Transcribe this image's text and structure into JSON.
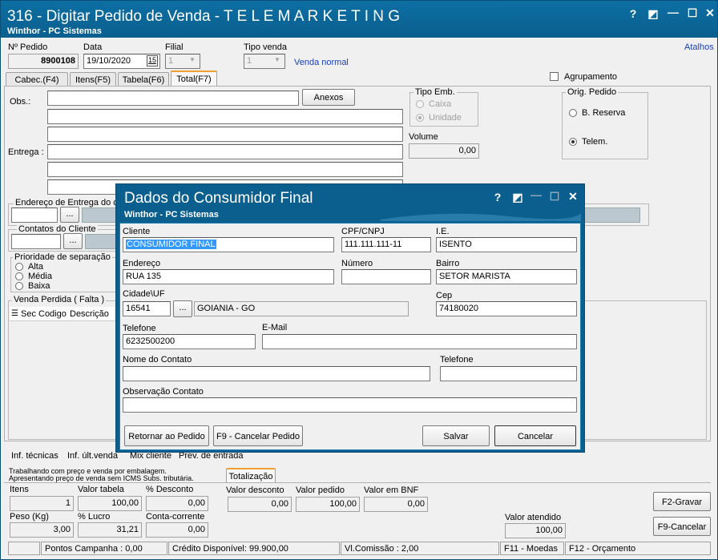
{
  "window": {
    "title": "316 - Digitar Pedido de Venda - T E L E M A R K E T I N G",
    "subtitle": "Winthor - PC Sistemas",
    "atalhos": "Atalhos",
    "buttons": {
      "help": "?",
      "restore": "◩",
      "minimize": "—",
      "maximize": "☐",
      "close": "✕"
    }
  },
  "header": {
    "pedido_label": "Nº Pedido",
    "pedido_value": "8900108",
    "data_label": "Data",
    "data_value": "19/10/2020",
    "calendar": "15",
    "filial_label": "Filial",
    "filial_value": "1",
    "tipo_venda_label": "Tipo venda",
    "tipo_venda_value": "1",
    "tipo_venda_desc": "Venda normal",
    "agrupamento": "Agrupamento"
  },
  "tabs": [
    {
      "label": "Cabec.(F4)"
    },
    {
      "label": "Itens(F5)"
    },
    {
      "label": "Tabela(F6)"
    },
    {
      "label": "Total(F7)"
    }
  ],
  "main": {
    "obs_label": "Obs.:",
    "anexos": "Anexos",
    "entrega_label": "Entrega :",
    "tipo_emb_label": "Tipo Emb.",
    "caixa": "Caixa",
    "unidade": "Unidade",
    "volume_label": "Volume",
    "volume_value": "0,00",
    "orig_pedido_label": "Orig. Pedido",
    "b_reserva": "B. Reserva",
    "telem": "Telem.",
    "endereco_entrega": "Endereço de Entrega do cl",
    "contatos": "Contatos do Cliente",
    "ellipsis": "...",
    "prioridade_label": "Prioridade de separação",
    "alta": "Alta",
    "media": "Média",
    "baixa": "Baixa",
    "venda_perdida": "Venda Perdida ( Falta )",
    "grid_cols": [
      "Sec",
      "Codigo",
      "Descrição"
    ]
  },
  "bottom_links": [
    "Inf. técnicas",
    "Inf. últ.venda",
    "Mix cliente",
    "Prev. de entrada"
  ],
  "info_text": [
    "Trabalhando com preço e venda por embalagem.",
    "Apresentando preço de venda sem ICMS Subs. tributária."
  ],
  "totalizacao_tab": "Totalização",
  "totals": {
    "itens_label": "Itens",
    "itens_value": "1",
    "valor_tabela_label": "Valor tabela",
    "valor_tabela_value": "100,00",
    "pct_desconto_label": "% Desconto",
    "pct_desconto_value": "0,00",
    "peso_label": "Peso (Kg)",
    "peso_value": "3,00",
    "pct_lucro_label": "% Lucro",
    "pct_lucro_value": "31,21",
    "conta_corrente_label": "Conta-corrente",
    "conta_corrente_value": "0,00",
    "valor_desconto_label": "Valor desconto",
    "valor_desconto_value": "0,00",
    "valor_pedido_label": "Valor pedido",
    "valor_pedido_value": "100,00",
    "valor_bnf_label": "Valor em BNF",
    "valor_bnf_value": "0,00",
    "valor_atendido_label": "Valor atendido",
    "valor_atendido_value": "100,00"
  },
  "actions": {
    "gravar": "F2-Gravar",
    "cancelar": "F9-Cancelar"
  },
  "status": {
    "pontos": "Pontos Campanha : 0,00",
    "credito": "Crédito Disponível: 99.900,00",
    "comissao": "Vl.Comissão : 2,00",
    "moedas": "F11 - Moedas",
    "orcamento": "F12 - Orçamento"
  },
  "dialog": {
    "title": "Dados do Consumidor Final",
    "subtitle": "Winthor - PC Sistemas",
    "cliente_label": "Cliente",
    "cliente_value": "CONSUMIDOR FINAL",
    "cpf_label": "CPF/CNPJ",
    "cpf_value": "111.111.111-11",
    "ie_label": "I.E.",
    "ie_value": "ISENTO",
    "endereco_label": "Endereço",
    "endereco_value": "RUA 135",
    "numero_label": "Número",
    "numero_value": "",
    "bairro_label": "Bairro",
    "bairro_value": "SETOR MARISTA",
    "cidade_label": "Cidade\\UF",
    "cidade_code": "16541",
    "cidade_name": "GOIANIA - GO",
    "cep_label": "Cep",
    "cep_value": "74180020",
    "telefone_label": "Telefone",
    "telefone_value": "6232500200",
    "email_label": "E-Mail",
    "email_value": "",
    "nome_contato_label": "Nome do Contato",
    "telefone2_label": "Telefone",
    "obs_contato_label": "Observação Contato",
    "btn_retornar": "Retornar ao Pedido",
    "btn_cancelar_pedido": "F9 - Cancelar Pedido",
    "btn_salvar": "Salvar",
    "btn_cancelar": "Cancelar"
  }
}
